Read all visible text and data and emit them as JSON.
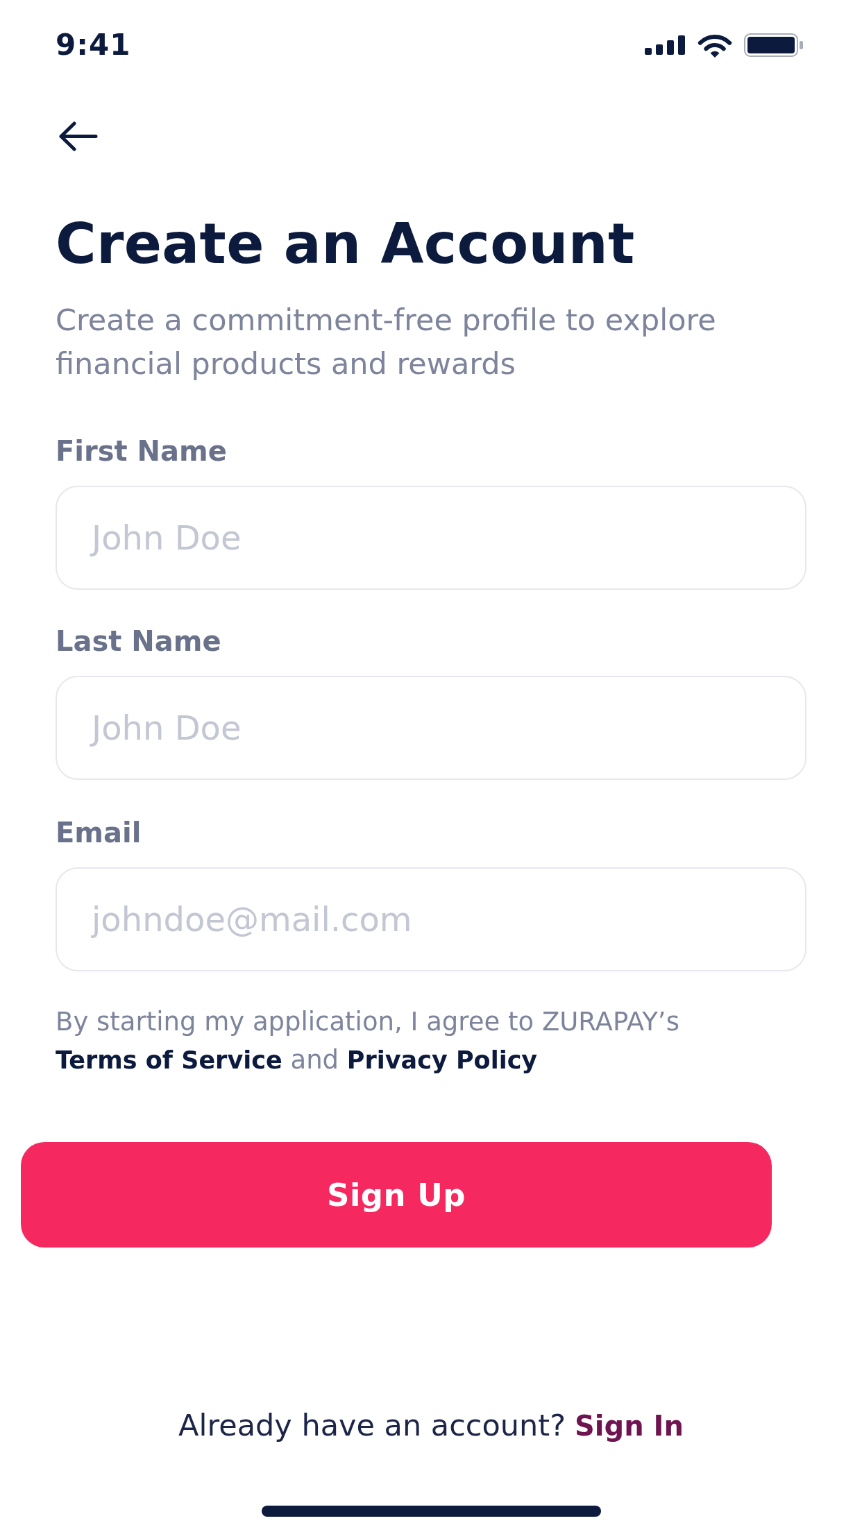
{
  "status_bar": {
    "time": "9:41"
  },
  "header": {
    "title": "Create an Account",
    "subtitle": "Create a commitment-free profile to explore financial products and rewards"
  },
  "form": {
    "fields": [
      {
        "label": "First Name",
        "placeholder": "John Doe"
      },
      {
        "label": "Last Name",
        "placeholder": "John Doe"
      },
      {
        "label": "Email",
        "placeholder": "johndoe@mail.com"
      }
    ]
  },
  "consent": {
    "parts": [
      {
        "kind": "text",
        "text": "By starting my application, I agree to ZURAPAY’s"
      },
      {
        "kind": "link",
        "text": "Terms of Service"
      },
      {
        "kind": "text",
        "text": "and"
      },
      {
        "kind": "link",
        "text": "Privacy Policy"
      }
    ]
  },
  "primary_button": {
    "label": "Sign Up"
  },
  "footer": {
    "prompt": "Already have an account?",
    "link": "Sign In"
  }
}
